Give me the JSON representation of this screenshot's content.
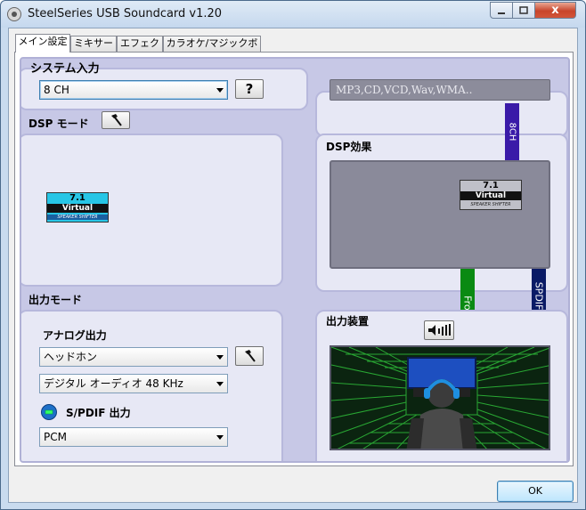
{
  "window": {
    "title": "SteelSeries USB Soundcard v1.20",
    "close_label": "x"
  },
  "tabs": [
    {
      "label": "メイン設定"
    },
    {
      "label": "ミキサー"
    },
    {
      "label": "エフェクト"
    },
    {
      "label": "カラオケ/マジックボイス"
    }
  ],
  "system_input": {
    "label": "システム入力",
    "channel_select": "8 CH",
    "help_label": "?",
    "source_display": "MP3,CD,VCD,Wav,WMA.."
  },
  "dsp_mode": {
    "label": "DSP モード",
    "badge": {
      "number": "7.1",
      "name": "Virtual",
      "sub": "SPEAKER SHIFTER"
    }
  },
  "dsp_effect": {
    "label": "DSP効果",
    "badge": {
      "number": "7.1",
      "name": "Virtual",
      "sub": "SPEAKER SHIFTER"
    }
  },
  "cables": {
    "ch8": "8CH",
    "front": "Front",
    "spdif": "SPDIF OUT"
  },
  "output_mode": {
    "label": "出力モード",
    "analog_label": "アナログ出力",
    "analog_select": "ヘッドホン",
    "digital_select": "デジタル オーディオ 48 KHz",
    "spdif_label": "S/PDIF 出力",
    "spdif_select": "PCM"
  },
  "output_device": {
    "label": "出力装置"
  },
  "footer": {
    "ok_label": "OK"
  },
  "colors": {
    "panel_bg": "#c7c8e6",
    "cable_8ch": "#3a1aa8",
    "cable_front": "#0a8a12",
    "cable_spdif": "#0a1a66",
    "badge_cyan": "#27c6e6"
  }
}
